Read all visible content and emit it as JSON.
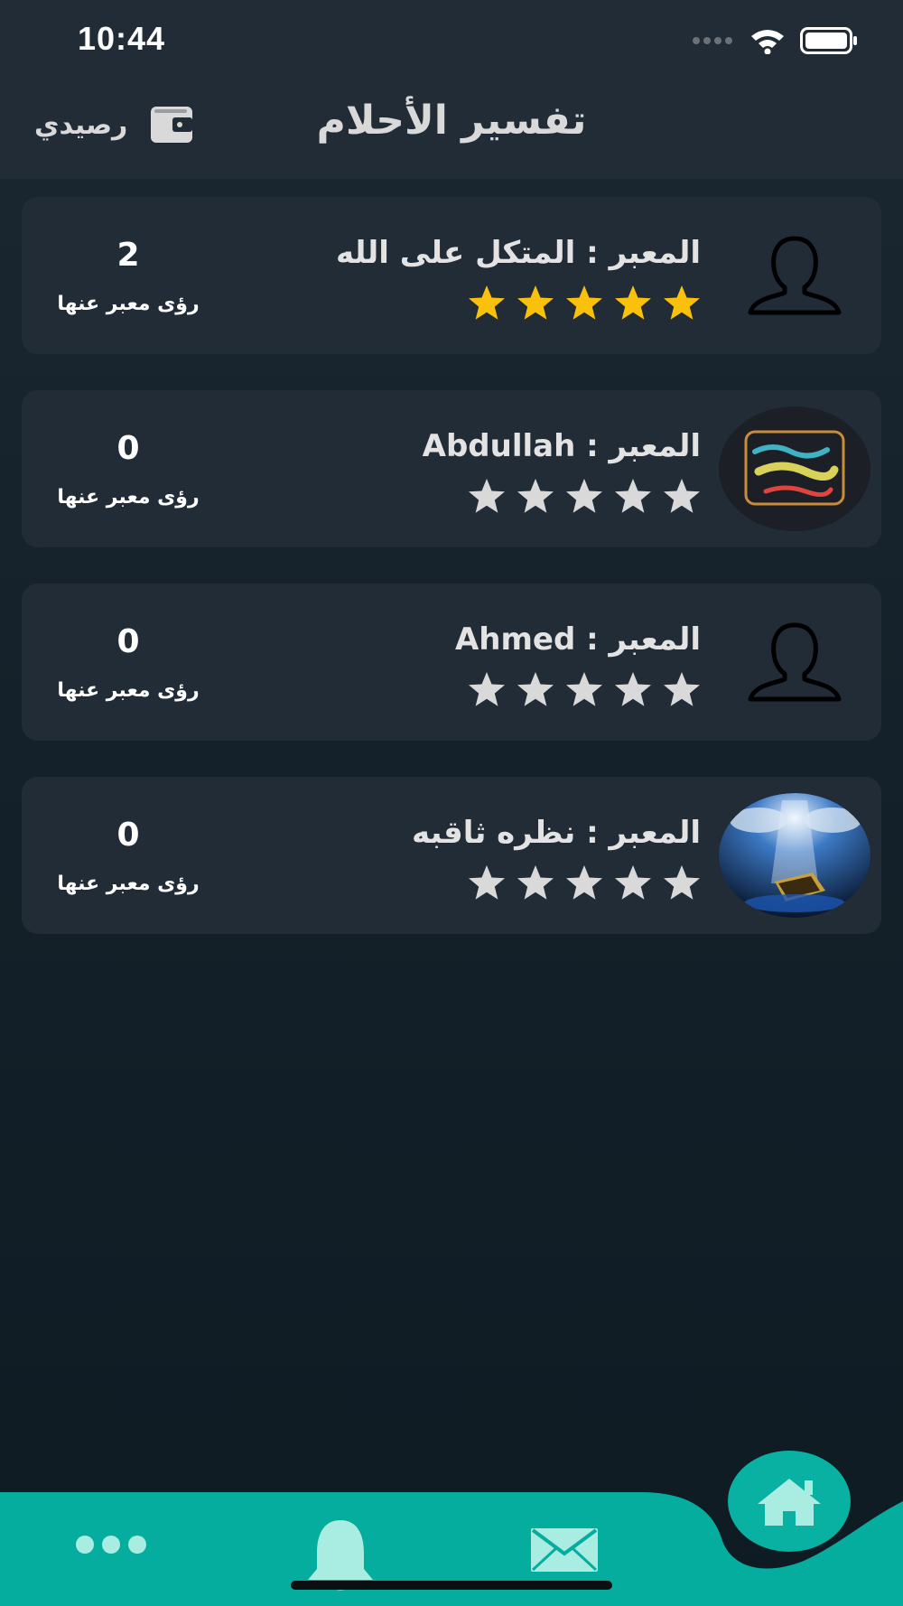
{
  "status_bar": {
    "time": "10:44",
    "icons": [
      "signal-icon",
      "wifi-icon",
      "battery-icon"
    ]
  },
  "header": {
    "title": "تفسير الأحلام",
    "wallet_label": "رصيدي",
    "wallet_icon": "wallet-icon"
  },
  "interpreters": [
    {
      "name": "المعبر : المتكل على الله",
      "rating": 5,
      "count": "2",
      "count_label": "رؤى معبر عنها",
      "avatar": "default-person-icon"
    },
    {
      "name": "المعبر : Abdullah",
      "rating": 0,
      "count": "0",
      "count_label": "رؤى معبر عنها",
      "avatar": "calligraphy-image"
    },
    {
      "name": "المعبر : Ahmed",
      "rating": 0,
      "count": "0",
      "count_label": "رؤى معبر عنها",
      "avatar": "default-person-icon"
    },
    {
      "name": "المعبر : نظره ثاقبه",
      "rating": 0,
      "count": "0",
      "count_label": "رؤى معبر عنها",
      "avatar": "quran-light-image"
    }
  ],
  "bottom_nav": {
    "items": [
      "more-icon",
      "bell-icon",
      "mail-icon",
      "home-icon"
    ],
    "active": "home-icon"
  },
  "colors": {
    "accent": "#05ad9e",
    "star_filled": "#f9c00c",
    "star_empty": "#d9d9d9",
    "card": "#222c37",
    "header": "#222c36"
  }
}
